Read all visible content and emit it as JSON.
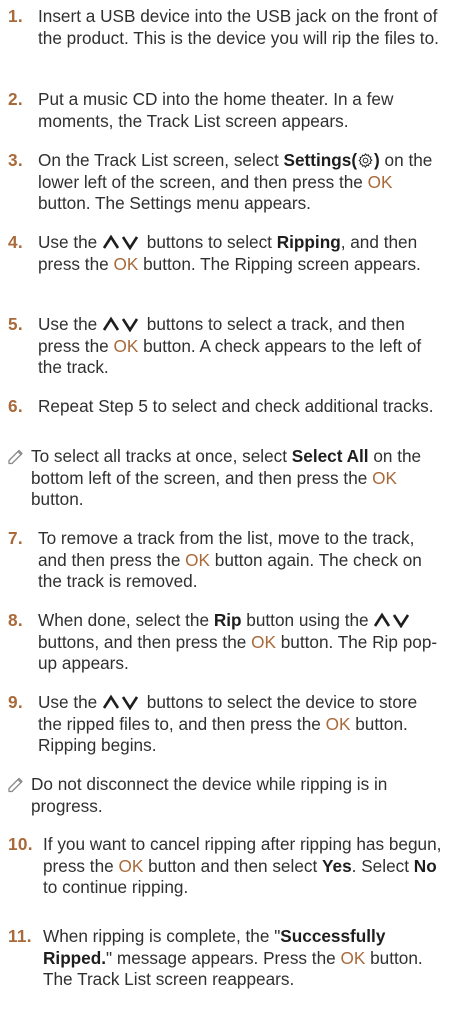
{
  "colors": {
    "accent": "#a86a3a",
    "text": "#303030"
  },
  "ok": "OK",
  "steps": [
    {
      "num": "1.",
      "text": "Insert a USB device into the USB jack on the front of the product. This is the device you will rip the files to."
    },
    {
      "num": "2.",
      "text": "Put a music CD into the home theater. In a few moments, the Track List screen appears."
    },
    {
      "num": "3.",
      "a": "On the Track List screen, select ",
      "b": "Settings(",
      "b_close": ")",
      "c": " on the lower left of the screen, and then press the ",
      "d": " button. The Settings menu appears."
    },
    {
      "num": "4.",
      "a": "Use the ",
      "b": " buttons to select ",
      "c": "Ripping",
      "d": ", and then press the ",
      "e": " button. The Ripping screen appears."
    },
    {
      "num": "5.",
      "a": "Use the ",
      "b": " buttons to select a track, and then press the ",
      "c": " button. A check appears to the left of the track."
    },
    {
      "num": "6.",
      "text": "Repeat Step 5 to select and check additional tracks."
    },
    {
      "kind": "note",
      "a": "To select all tracks at once, select ",
      "b": "Select All",
      "c": " on the bottom left of the screen, and then press the ",
      "d": " button."
    },
    {
      "num": "7.",
      "a": "To remove a track from the list, move to the track, and then press the ",
      "b": " button again. The check on the track is removed."
    },
    {
      "num": "8.",
      "a": "When done, select the ",
      "b": "Rip",
      "c": " button using the ",
      "d": " buttons, and then press the ",
      "e": " button. The Rip pop-up appears."
    },
    {
      "num": "9.",
      "a": "Use the ",
      "b": " buttons to select the device to store the ripped files to, and then press the ",
      "c": " button. Ripping begins."
    },
    {
      "kind": "note",
      "text": "Do not disconnect the device while ripping is in progress."
    },
    {
      "num": "10.",
      "a": "If you want to cancel ripping after ripping has begun, press the ",
      "b": " button and then select ",
      "c": "Yes",
      "d": ". Select ",
      "e": "No",
      "f": " to continue ripping."
    },
    {
      "num": "11.",
      "a": "When ripping is complete, the \"",
      "b": "Successfully Ripped.",
      "c": "\" message appears. Press the ",
      "d": " button. The Track List screen reappears."
    }
  ]
}
